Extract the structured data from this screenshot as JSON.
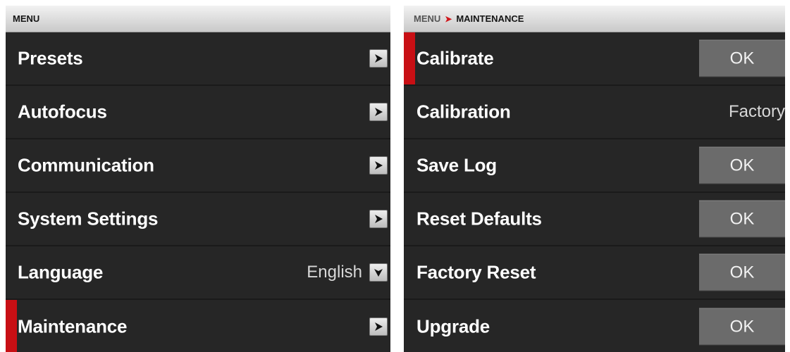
{
  "left_panel": {
    "header": "MENU",
    "items": [
      {
        "label": "Presets",
        "control": "chevron-right"
      },
      {
        "label": "Autofocus",
        "control": "chevron-right"
      },
      {
        "label": "Communication",
        "control": "chevron-right"
      },
      {
        "label": "System Settings",
        "control": "chevron-right"
      },
      {
        "label": "Language",
        "value": "English",
        "control": "chevron-down"
      },
      {
        "label": "Maintenance",
        "control": "chevron-right",
        "selected": true
      }
    ]
  },
  "right_panel": {
    "breadcrumb": {
      "root": "MENU",
      "separator": "➤",
      "current": "MAINTENANCE"
    },
    "items": [
      {
        "label": "Calibrate",
        "button": "OK",
        "selected": true
      },
      {
        "label": "Calibration",
        "value": "Factory"
      },
      {
        "label": "Save Log",
        "button": "OK"
      },
      {
        "label": "Reset Defaults",
        "button": "OK"
      },
      {
        "label": "Factory Reset",
        "button": "OK"
      },
      {
        "label": "Upgrade",
        "button": "OK"
      }
    ]
  },
  "colors": {
    "panel_bg": "#262626",
    "selection_accent": "#c80f14",
    "ok_button_bg": "#6b6b6b",
    "header_bg": "#dcdcdc"
  }
}
